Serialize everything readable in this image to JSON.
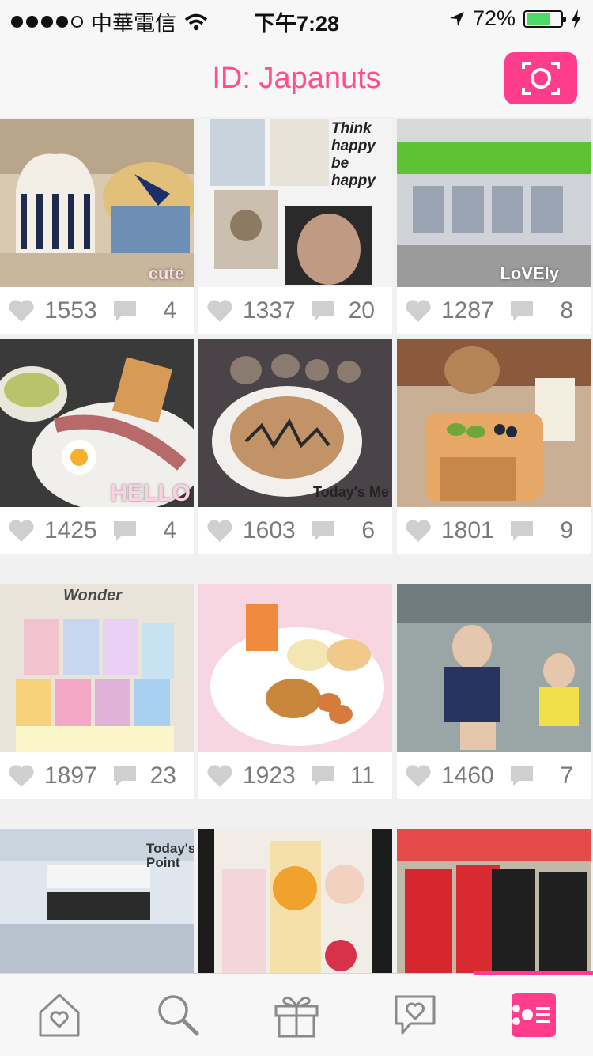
{
  "status_bar": {
    "carrier": "中華電信",
    "time": "下午7:28",
    "battery_percent": "72%",
    "battery_level": 0.72
  },
  "header": {
    "title": "ID: Japanuts",
    "action_icon": "camera-frame-icon"
  },
  "photos": [
    {
      "likes": "1553",
      "comments": "4",
      "caption": "cute"
    },
    {
      "likes": "1337",
      "comments": "20",
      "caption": "Think happy be happy"
    },
    {
      "likes": "1287",
      "comments": "8",
      "caption": "LoVEly"
    },
    {
      "likes": "1425",
      "comments": "4",
      "caption": "HELLO"
    },
    {
      "likes": "1603",
      "comments": "6",
      "caption": "Today's Me"
    },
    {
      "likes": "1801",
      "comments": "9",
      "caption": ""
    },
    {
      "likes": "1897",
      "comments": "23",
      "caption": "Wonder"
    },
    {
      "likes": "1923",
      "comments": "11",
      "caption": ""
    },
    {
      "likes": "1460",
      "comments": "7",
      "caption": ""
    },
    {
      "likes": "",
      "comments": "",
      "caption": "Today's Point"
    },
    {
      "likes": "",
      "comments": "",
      "caption": ""
    },
    {
      "likes": "",
      "comments": "",
      "caption": ""
    }
  ],
  "tabs": [
    {
      "icon": "home-heart-icon",
      "active": false
    },
    {
      "icon": "search-icon",
      "active": false
    },
    {
      "icon": "gift-icon",
      "active": false
    },
    {
      "icon": "chat-heart-icon",
      "active": false
    },
    {
      "icon": "profile-card-icon",
      "active": true
    }
  ],
  "colors": {
    "accent": "#ff3d8a",
    "title": "#ff4d8e",
    "stat_gray": "#7a7a7a"
  }
}
